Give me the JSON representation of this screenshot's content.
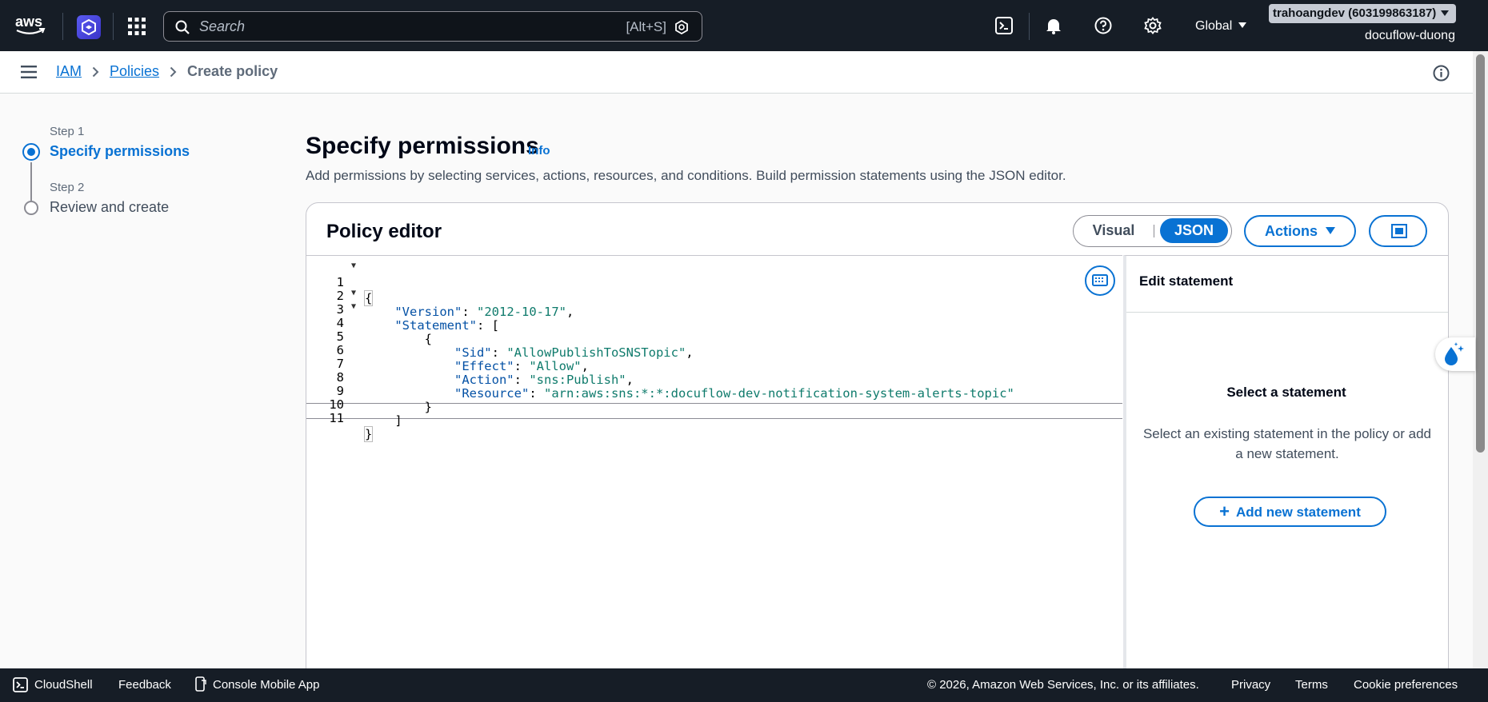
{
  "topnav": {
    "logo_text": "aws",
    "search_placeholder": "Search",
    "search_shortcut": "[Alt+S]",
    "region": "Global",
    "account": "trahoangdev (603199863187)",
    "username": "docuflow-duong"
  },
  "breadcrumb": {
    "items": [
      "IAM",
      "Policies"
    ],
    "current": "Create policy"
  },
  "steps": [
    {
      "label": "Step 1",
      "title": "Specify permissions"
    },
    {
      "label": "Step 2",
      "title": "Review and create"
    }
  ],
  "header": {
    "title": "Specify permissions",
    "info": "Info",
    "description": "Add permissions by selecting services, actions, resources, and conditions. Build permission statements using the JSON editor."
  },
  "editor": {
    "title": "Policy editor",
    "mode_visual": "Visual",
    "mode_json": "JSON",
    "actions_label": "Actions",
    "code": {
      "version_key": "\"Version\"",
      "version_val": "\"2012-10-17\"",
      "statement_key": "\"Statement\"",
      "sid_key": "\"Sid\"",
      "sid_val": "\"AllowPublishToSNSTopic\"",
      "effect_key": "\"Effect\"",
      "effect_val": "\"Allow\"",
      "action_key": "\"Action\"",
      "action_val": "\"sns:Publish\"",
      "resource_key": "\"Resource\"",
      "resource_val": "\"arn:aws:sns:*:*:docuflow-dev-notification-system-alerts-topic\""
    },
    "line_numbers": [
      "1",
      "2",
      "3",
      "4",
      "5",
      "6",
      "7",
      "8",
      "9",
      "10",
      "11"
    ]
  },
  "side_panel": {
    "title": "Edit statement",
    "empty_title": "Select a statement",
    "empty_desc": "Select an existing statement in the policy or add a new statement.",
    "add_label": "Add new statement"
  },
  "footer": {
    "cloudshell": "CloudShell",
    "feedback": "Feedback",
    "mobile_app": "Console Mobile App",
    "copyright": "© 2026, Amazon Web Services, Inc. or its affiliates.",
    "privacy": "Privacy",
    "terms": "Terms",
    "cookies": "Cookie preferences"
  },
  "colors": {
    "nav_bg": "#161d26",
    "accent": "#0972d3",
    "json_key": "#0451a5",
    "json_string": "#0f7b6c"
  }
}
